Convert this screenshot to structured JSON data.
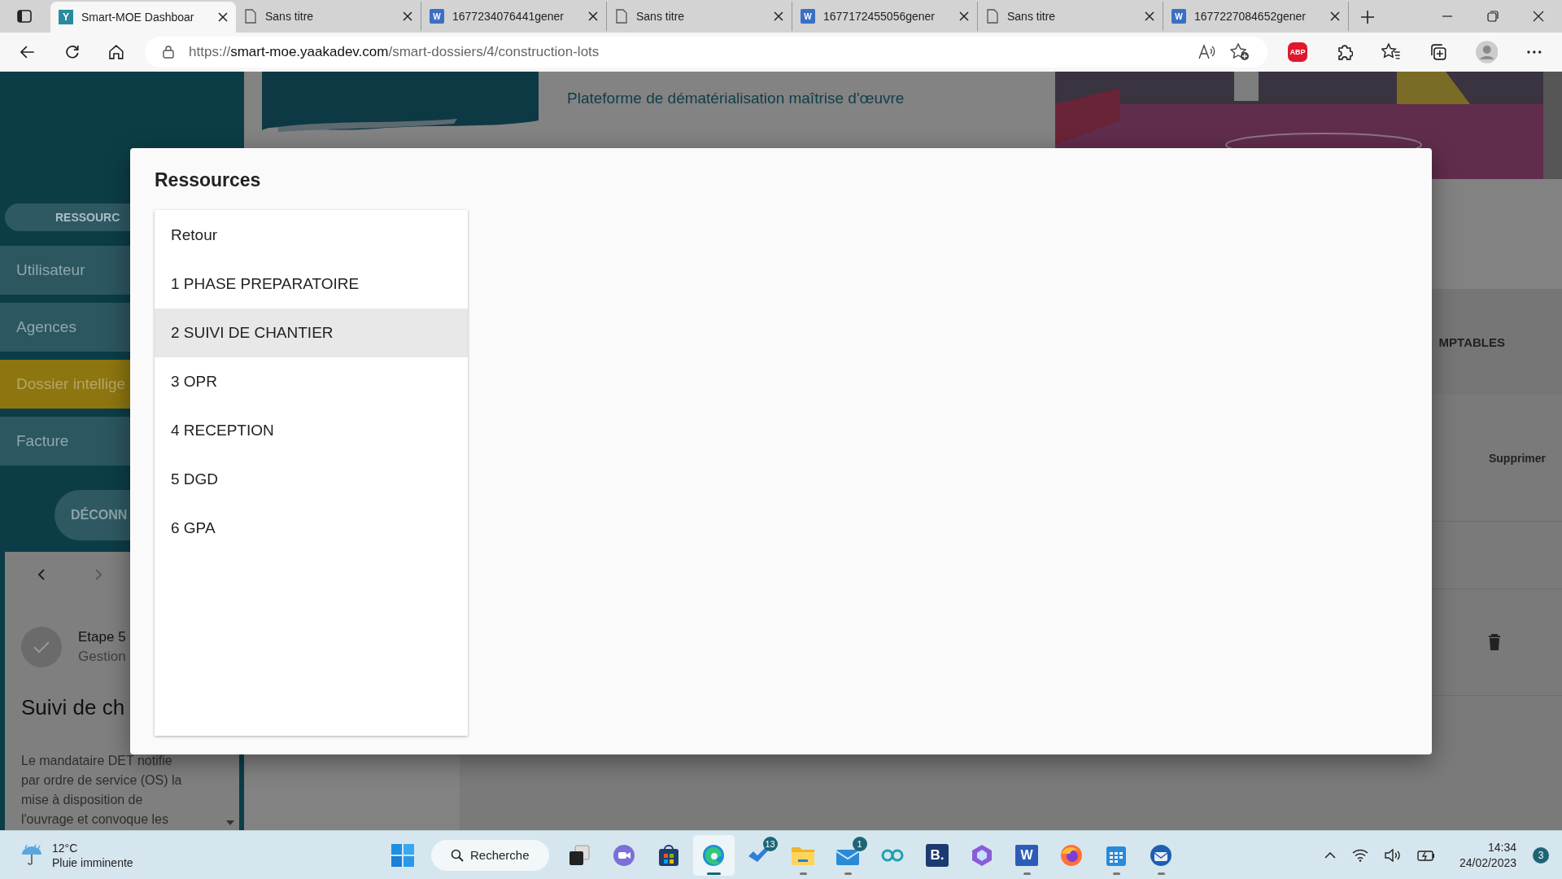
{
  "browser": {
    "tabs": [
      {
        "title": "Smart-MOE Dashboar",
        "kind": "site",
        "glyph": "Y",
        "selected": true
      },
      {
        "title": "Sans titre",
        "kind": "page",
        "selected": false
      },
      {
        "title": "1677234076441gener",
        "kind": "word",
        "glyph": "W",
        "selected": false
      },
      {
        "title": "Sans titre",
        "kind": "page",
        "selected": false
      },
      {
        "title": "1677172455056gener",
        "kind": "word",
        "glyph": "W",
        "selected": false
      },
      {
        "title": "Sans titre",
        "kind": "page",
        "selected": false
      },
      {
        "title": "1677227084652gener",
        "kind": "word",
        "glyph": "W",
        "selected": false
      }
    ],
    "url_scheme": "https://",
    "url_host": "smart-moe.yaakadev.com",
    "url_path": "/smart-dossiers/4/construction-lots",
    "toolbar": [
      {
        "kind": "read"
      },
      {
        "kind": "fav-add"
      },
      {
        "kind": "abp",
        "glyph": "ABP"
      },
      {
        "kind": "puzzle"
      },
      {
        "kind": "favorites"
      },
      {
        "kind": "collections"
      },
      {
        "kind": "profile"
      },
      {
        "kind": "more"
      }
    ]
  },
  "header": {
    "subtitle": "Plateforme de dématérialisation maîtrise d'œuvre"
  },
  "sidebar": {
    "section_button": "RESSOURC",
    "items": [
      {
        "label": "Utilisateur",
        "selected": false
      },
      {
        "label": "Agences",
        "selected": false
      },
      {
        "label": "Dossier intellige",
        "selected": true
      },
      {
        "label": "Facture",
        "selected": false
      }
    ],
    "logout": "DÉCONN",
    "card": {
      "step_title": "Etape 5",
      "step_sub": "Gestion",
      "heading": "Suivi de ch",
      "text": "Le mandataire DET notifie par ordre de service (OS) la mise à disposition de l'ouvrage et convoque les"
    }
  },
  "content": {
    "tab_label": "MPTABLES",
    "column_label": "Supprimer"
  },
  "modal": {
    "title": "Ressources",
    "items": [
      {
        "label": "Retour",
        "selected": false
      },
      {
        "label": "1 PHASE PREPARATOIRE",
        "selected": false
      },
      {
        "label": "2 SUIVI DE CHANTIER",
        "selected": true
      },
      {
        "label": "3 OPR",
        "selected": false
      },
      {
        "label": "4 RECEPTION",
        "selected": false
      },
      {
        "label": "5 DGD",
        "selected": false
      },
      {
        "label": "6 GPA",
        "selected": false
      }
    ]
  },
  "taskbar": {
    "weather": {
      "temp": "12°C",
      "desc": "Pluie imminente"
    },
    "search": "Recherche",
    "apps": [
      {
        "kind": "taskview",
        "running": false,
        "selected": false
      },
      {
        "kind": "teams",
        "running": false,
        "selected": false
      },
      {
        "kind": "store",
        "running": false,
        "selected": false
      },
      {
        "kind": "edge",
        "running": true,
        "selected": true
      },
      {
        "kind": "todo",
        "badge": "13",
        "running": false,
        "selected": false
      },
      {
        "kind": "folder",
        "running": true,
        "selected": false
      },
      {
        "kind": "mail",
        "badge": "1",
        "running": true,
        "selected": false
      },
      {
        "kind": "loop",
        "running": false,
        "selected": false
      },
      {
        "kind": "booking",
        "glyph": "B.",
        "running": false,
        "selected": false
      },
      {
        "kind": "copilot",
        "running": false,
        "selected": false
      },
      {
        "kind": "word",
        "glyph": "W",
        "running": true,
        "selected": false
      },
      {
        "kind": "firefox",
        "running": false,
        "selected": false
      },
      {
        "kind": "calendar",
        "running": true,
        "selected": false
      },
      {
        "kind": "thunderbird",
        "running": true,
        "selected": false
      }
    ],
    "time": "14:34",
    "date": "24/02/2023",
    "notifications": "3"
  }
}
